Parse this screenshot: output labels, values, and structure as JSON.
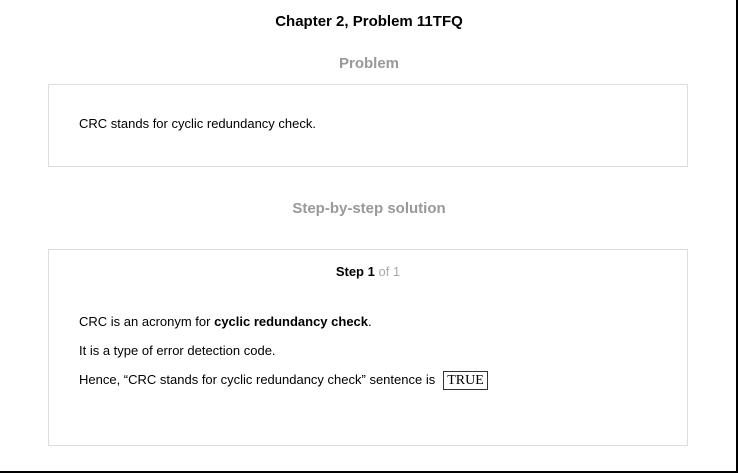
{
  "header": {
    "title": "Chapter 2, Problem 11TFQ"
  },
  "problem": {
    "heading": "Problem",
    "text": "CRC stands for cyclic redundancy check."
  },
  "solution": {
    "heading": "Step-by-step solution",
    "step_label": "Step 1",
    "step_of": "of 1",
    "line1_pre": "CRC is an acronym for ",
    "line1_bold": "cyclic redundancy check",
    "line1_post": ".",
    "line2": "It is a type of error detection code.",
    "line3": "Hence, “CRC stands for cyclic redundancy check” sentence is",
    "answer": "TRUE"
  }
}
